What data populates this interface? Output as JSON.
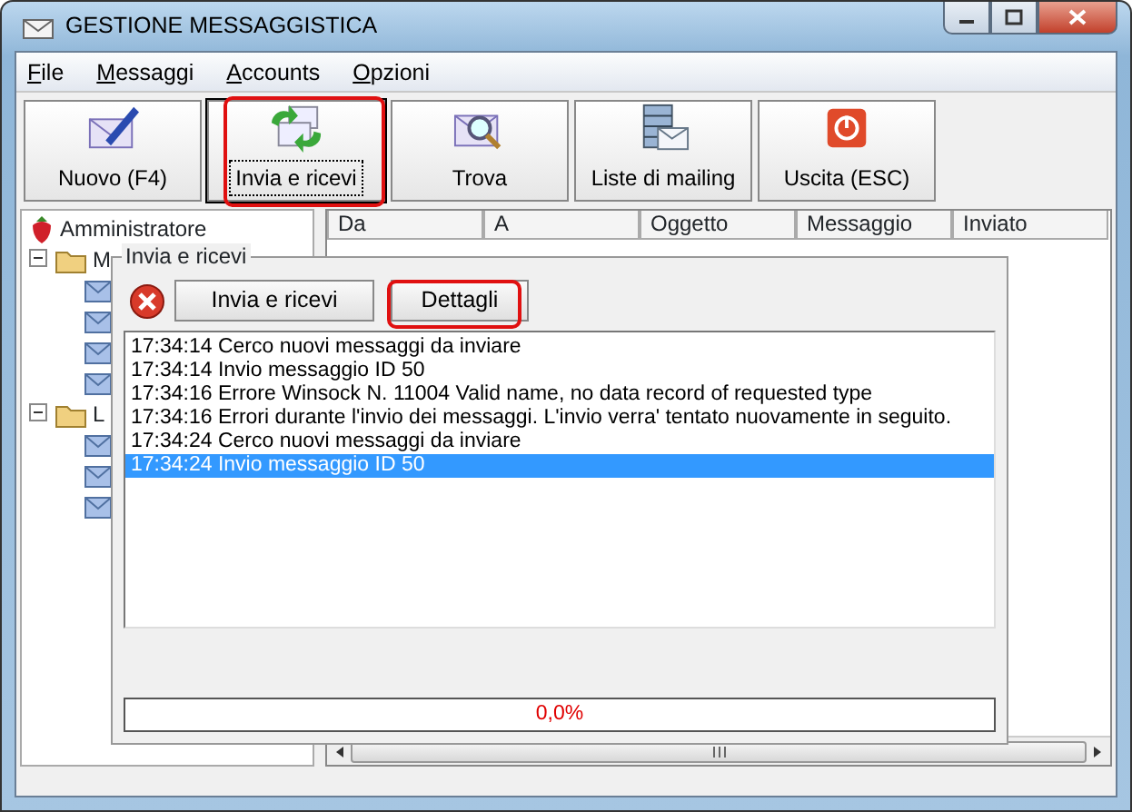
{
  "window": {
    "title": "GESTIONE MESSAGGISTICA"
  },
  "menu": [
    {
      "label": "File"
    },
    {
      "label": "Messaggi"
    },
    {
      "label": "Accounts"
    },
    {
      "label": "Opzioni"
    }
  ],
  "toolbar": [
    {
      "label": "Nuovo (F4)",
      "focused": false,
      "highlighted": false
    },
    {
      "label": "Invia e ricevi",
      "focused": true,
      "highlighted": true
    },
    {
      "label": "Trova",
      "focused": false,
      "highlighted": false
    },
    {
      "label": "Liste di mailing",
      "focused": false,
      "highlighted": false
    },
    {
      "label": "Uscita (ESC)",
      "focused": false,
      "highlighted": false
    }
  ],
  "tree": {
    "root": "Amministratore",
    "children": [
      {
        "label": "M",
        "expanded": true,
        "children": [
          {
            "kind": "item"
          },
          {
            "kind": "item"
          },
          {
            "kind": "item"
          },
          {
            "kind": "item"
          }
        ]
      },
      {
        "label": "L",
        "expanded": true,
        "children": [
          {
            "kind": "item"
          },
          {
            "kind": "item"
          },
          {
            "kind": "item"
          }
        ]
      }
    ]
  },
  "table": {
    "columns": [
      "Da",
      "A",
      "Oggetto",
      "Messaggio",
      "Inviato"
    ]
  },
  "dialog": {
    "title": "Invia e ricevi",
    "buttons": [
      {
        "label": "Invia e ricevi",
        "highlighted": false
      },
      {
        "label": "Dettagli",
        "highlighted": true
      }
    ],
    "log": [
      {
        "text": "17:34:14 Cerco nuovi messaggi da inviare",
        "selected": false
      },
      {
        "text": "17:34:14 Invio messaggio ID 50",
        "selected": false
      },
      {
        "text": "17:34:16 Errore Winsock N. 11004 Valid name, no data record of requested type",
        "selected": false
      },
      {
        "text": "17:34:16 Errori durante l'invio dei messaggi. L'invio verra' tentato nuovamente in seguito.",
        "selected": false
      },
      {
        "text": "17:34:24 Cerco nuovi messaggi da inviare",
        "selected": false
      },
      {
        "text": "17:34:24 Invio messaggio ID 50",
        "selected": true
      }
    ],
    "progress": {
      "level": 0,
      "reading": "0,0%"
    }
  }
}
